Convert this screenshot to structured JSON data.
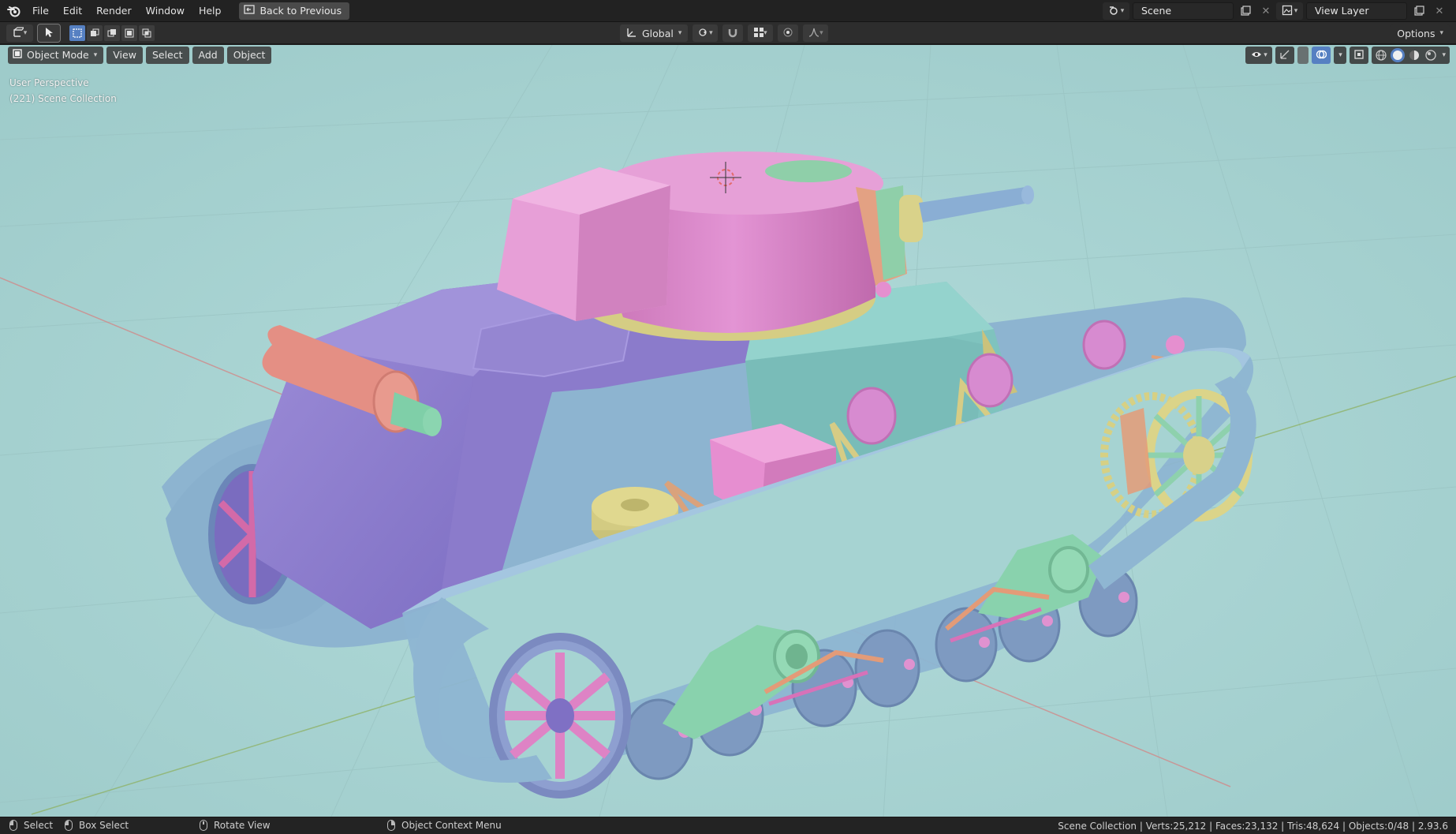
{
  "topbar": {
    "menu": [
      "File",
      "Edit",
      "Render",
      "Window",
      "Help"
    ],
    "back_button": "Back to Previous",
    "scene_name": "Scene",
    "view_layer_name": "View Layer"
  },
  "header": {
    "transform_orientation": "Global",
    "options_label": "Options"
  },
  "viewport": {
    "mode_label": "Object Mode",
    "menus": [
      "View",
      "Select",
      "Add",
      "Object"
    ],
    "view_name": "User Perspective",
    "collection_info": "(221) Scene Collection"
  },
  "statusbar": {
    "select": "Select",
    "box_select": "Box Select",
    "rotate_view": "Rotate View",
    "context_menu": "Object Context Menu",
    "stats": "Scene Collection | Verts:25,212 | Faces:23,132 | Tris:48,624 | Objects:0/48 | 2.93.6"
  },
  "colors": {
    "viewport_bg": "#a6d3d2",
    "accent_blue": "#5680c2",
    "hull_purple": "#8d7fcf",
    "turret_pink": "#d889c7",
    "track_blue": "#8fb6d2",
    "bogie_green": "#8cd1b0",
    "drum_yellow": "#d8d48c",
    "exhaust_salmon": "#e89288"
  }
}
